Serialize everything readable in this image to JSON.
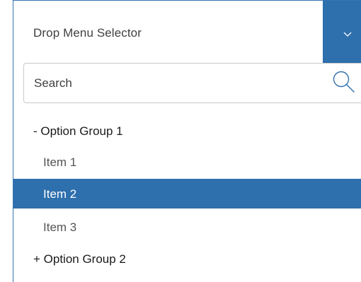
{
  "selector": {
    "label": "Drop Menu Selector",
    "toggle_icon": "chevron-down-icon"
  },
  "search": {
    "placeholder": "Search",
    "value": "",
    "icon": "search-icon"
  },
  "groups": [
    {
      "label": "- Option Group 1",
      "expanded": true,
      "items": [
        {
          "label": "Item 1",
          "selected": false
        },
        {
          "label": "Item 2",
          "selected": true
        },
        {
          "label": "Item 3",
          "selected": false
        }
      ]
    },
    {
      "label": "+ Option Group 2",
      "expanded": false,
      "items": []
    }
  ],
  "colors": {
    "accent": "#2e6fad",
    "selected_text": "#ffffff",
    "item_text": "#555555",
    "border": "#c9c9c9"
  }
}
